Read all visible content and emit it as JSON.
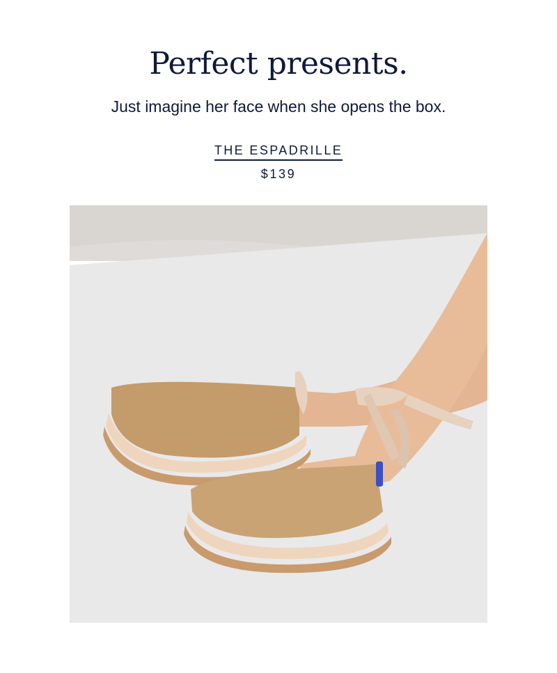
{
  "hero": {
    "headline": "Perfect presents.",
    "subhead": "Just imagine her face when she opens the box."
  },
  "product": {
    "name": "THE ESPADRILLE",
    "price": "$139",
    "image_alt": "Woman's legs wearing woven tan espadrille flats with cream ankle ties"
  },
  "colors": {
    "text": "#0f1a3a",
    "background": "#ffffff",
    "wall": "#d9d6d2",
    "floor": "#e9e9ea",
    "shoe": "#c7a274",
    "ribbon": "#e6d2bf",
    "skin": "#e5b896"
  }
}
